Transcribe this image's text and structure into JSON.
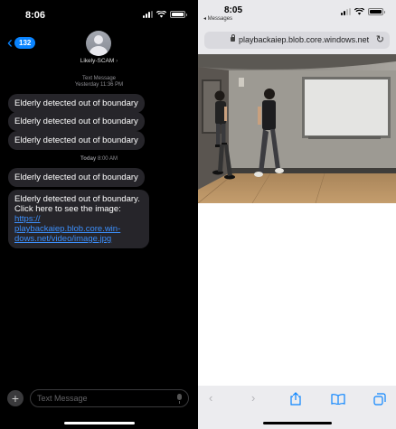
{
  "messages_screen": {
    "status_time": "8:06",
    "back_count": "132",
    "contact_name": "Likely-SCAM",
    "stamp_first_kind": "Text Message",
    "stamp_first_when": "Yesterday 11:36 PM",
    "bubbles_yesterday": [
      "Elderly detected out of boundary",
      "Elderly detected out of boundary",
      "Elderly detected out of boundary"
    ],
    "stamp_second_day": "Today",
    "stamp_second_time": "8:00 AM",
    "bubble_today_1": "Elderly detected out of boundary",
    "bubble_today_2_line1": "Elderly detected out of boundary.",
    "bubble_today_2_line2": "Click here to see the image:",
    "bubble_today_2_link_1": "https://",
    "bubble_today_2_link_2": "playbackaiep.blob.core.win-",
    "bubble_today_2_link_3": "dows.net/video/image.jpg",
    "composer_placeholder": "Text Message"
  },
  "safari_screen": {
    "status_time": "8:05",
    "back_crumb": "◂ Messages",
    "url": "playbackaiep.blob.core.windows.net"
  },
  "icons": {
    "back": "chevron-left-icon",
    "add": "plus-icon",
    "mic": "microphone-icon",
    "lock": "lock-icon",
    "reload": "reload-icon",
    "share": "share-icon",
    "bookmarks": "book-icon",
    "tabs": "tabs-icon"
  },
  "colors": {
    "imessage_blue": "#0a84ff",
    "bubble_gray": "#26252a",
    "link_blue": "#3c8ffc"
  }
}
